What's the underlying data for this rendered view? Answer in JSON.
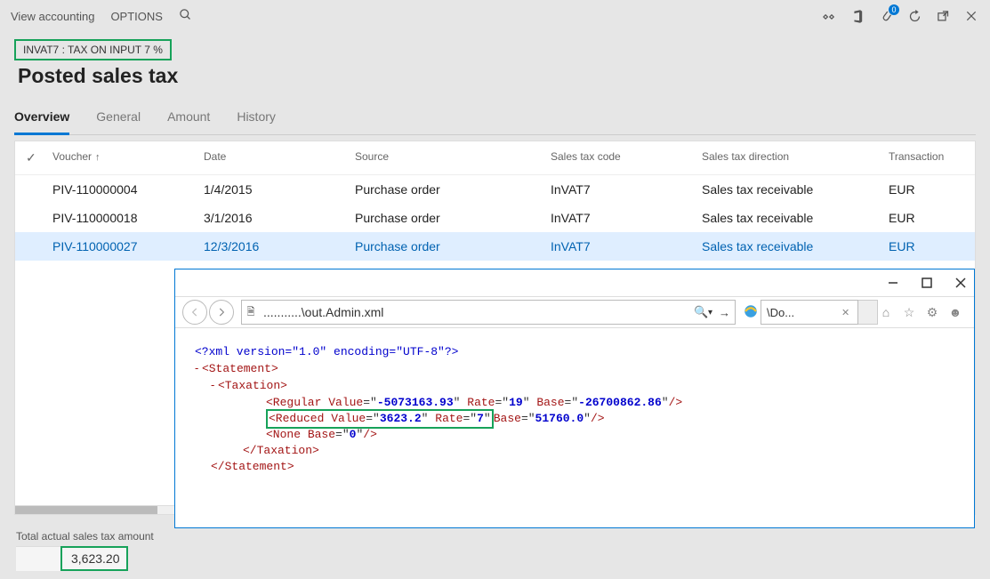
{
  "topbar": {
    "view_accounting": "View accounting",
    "options": "OPTIONS",
    "badge_count": "0"
  },
  "header": {
    "subtitle": "INVAT7 : TAX ON INPUT 7 %",
    "title": "Posted sales tax"
  },
  "tabs": {
    "overview": "Overview",
    "general": "General",
    "amount": "Amount",
    "history": "History"
  },
  "grid": {
    "columns": {
      "voucher": "Voucher",
      "date": "Date",
      "source": "Source",
      "sales_tax_code": "Sales tax code",
      "sales_tax_direction": "Sales tax direction",
      "transaction": "Transaction"
    },
    "rows": [
      {
        "voucher": "PIV-110000004",
        "date": "1/4/2015",
        "source": "Purchase order",
        "code": "InVAT7",
        "direction": "Sales tax receivable",
        "trans": "EUR"
      },
      {
        "voucher": "PIV-110000018",
        "date": "3/1/2016",
        "source": "Purchase order",
        "code": "InVAT7",
        "direction": "Sales tax receivable",
        "trans": "EUR"
      },
      {
        "voucher": "PIV-110000027",
        "date": "12/3/2016",
        "source": "Purchase order",
        "code": "InVAT7",
        "direction": "Sales tax receivable",
        "trans": "EUR"
      }
    ]
  },
  "total": {
    "label": "Total actual sales tax amount",
    "value": "3,623.20"
  },
  "overlay": {
    "address": "...........\\out.Admin.xml",
    "tab_label": "\\Do...",
    "xml": {
      "decl": "<?xml version=\"1.0\" encoding=\"UTF-8\"?>",
      "reg_value": "-5073163.93",
      "reg_rate": "19",
      "reg_base": "-26700862.86",
      "red_value": "3623.2",
      "red_rate": "7",
      "red_base": "51760.0",
      "none_base": "0"
    }
  }
}
